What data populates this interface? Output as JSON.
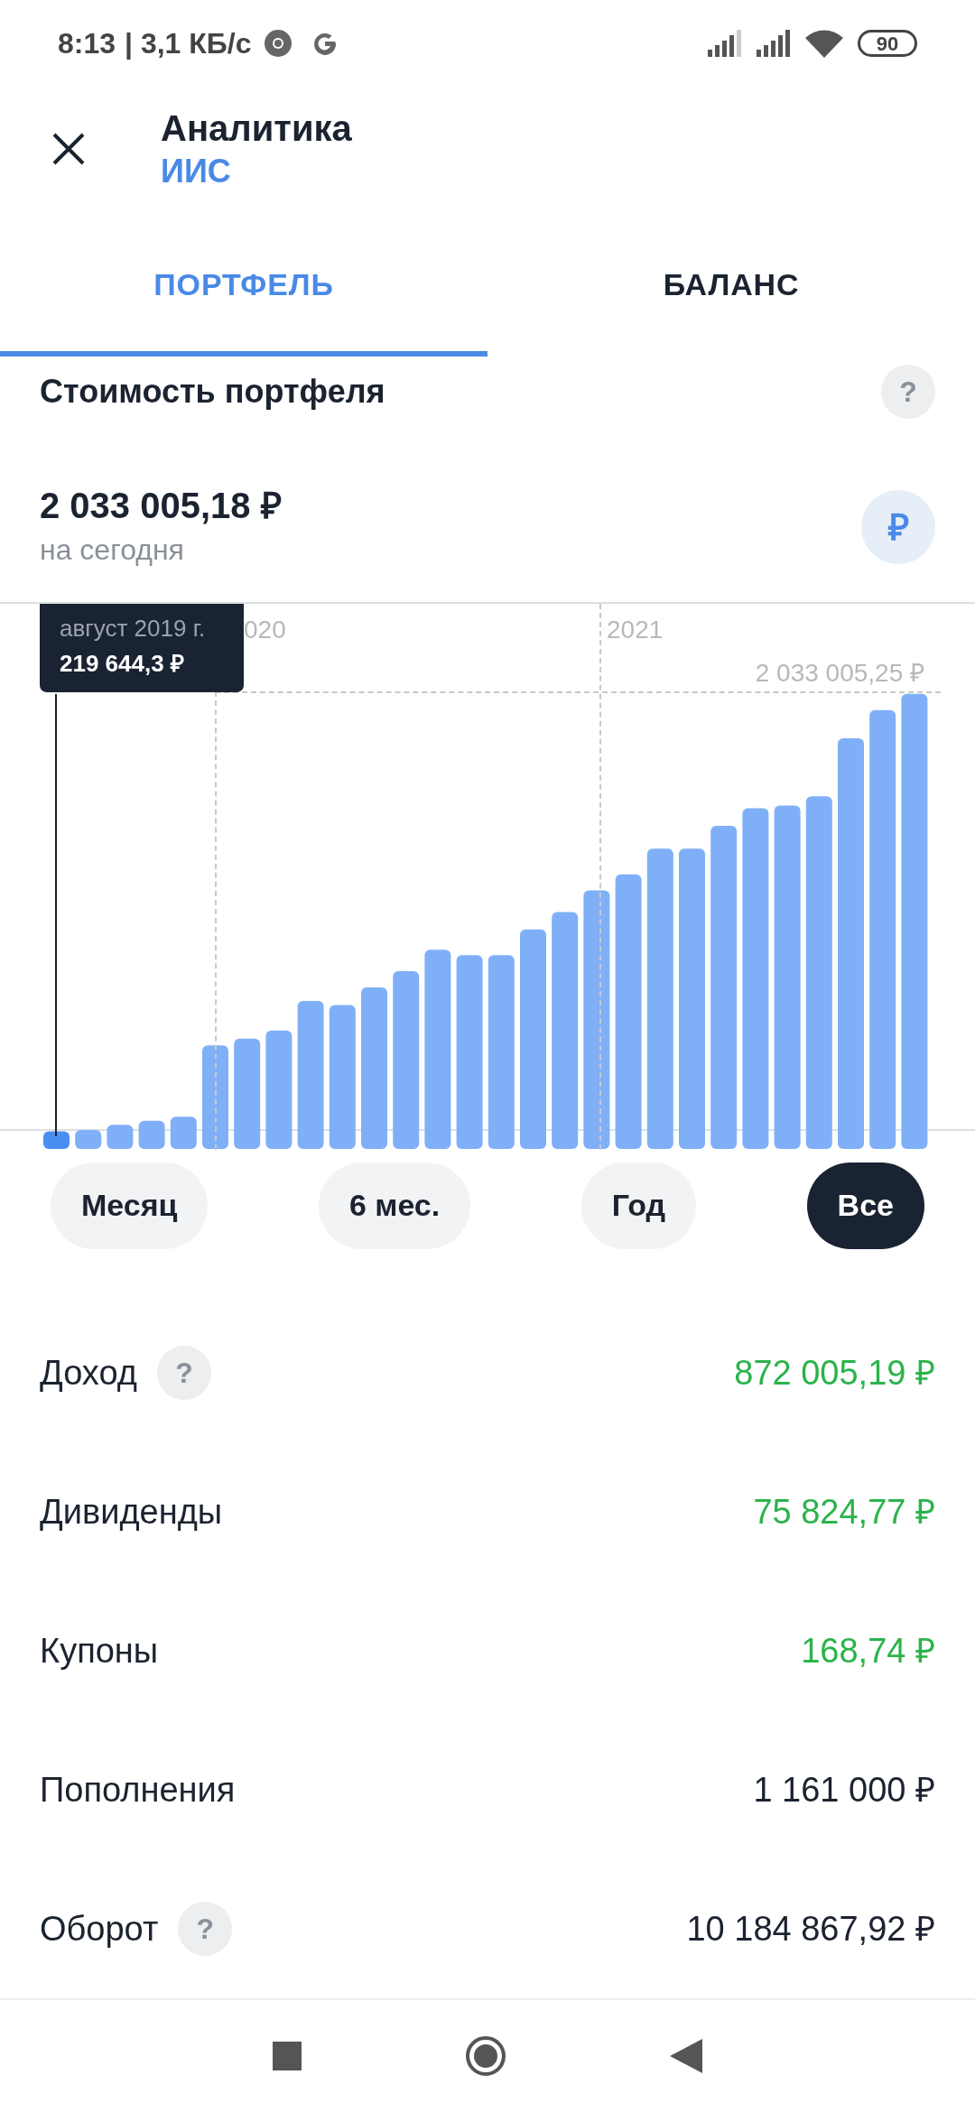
{
  "status_bar": {
    "time": "8:13",
    "speed": "| 3,1 КБ/с",
    "battery": "90"
  },
  "header": {
    "title": "Аналитика",
    "subtitle": "ИИС"
  },
  "tabs": [
    {
      "label": "ПОРТФЕЛЬ",
      "selected": true
    },
    {
      "label": "БАЛАНС",
      "selected": false
    }
  ],
  "section": {
    "title": "Стоимость портфеля",
    "help": "?"
  },
  "value": {
    "amount": "2 033 005,18 ₽",
    "caption": "на сегодня",
    "currency_button": "₽"
  },
  "chart": {
    "year_labels": [
      "020",
      "2021"
    ],
    "max_label": "2 033 005,25 ₽",
    "tooltip": {
      "date": "август 2019 г.",
      "amount": "219 644,3 ₽"
    }
  },
  "periods": [
    {
      "label": "Месяц",
      "selected": false
    },
    {
      "label": "6 мес.",
      "selected": false
    },
    {
      "label": "Год",
      "selected": false
    },
    {
      "label": "Все",
      "selected": true
    }
  ],
  "rows": [
    {
      "label": "Доход",
      "help": "?",
      "value": "872 005,19 ₽",
      "positive": true
    },
    {
      "label": "Дивиденды",
      "value": "75 824,77 ₽",
      "positive": true
    },
    {
      "label": "Купоны",
      "value": "168,74 ₽",
      "positive": true
    },
    {
      "label": "Пополнения",
      "value": "1 161 000 ₽",
      "positive": false
    },
    {
      "label": "Оборот",
      "help": "?",
      "value": "10 184 867,92 ₽",
      "positive": false
    }
  ]
}
